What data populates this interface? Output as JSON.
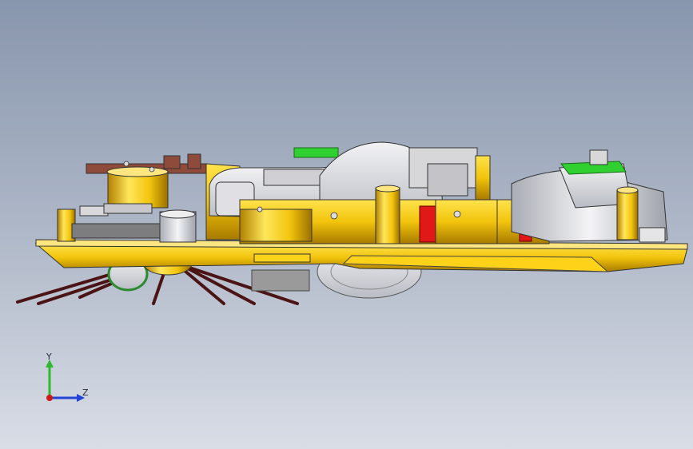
{
  "scene": {
    "background_top": "#8896ad",
    "background_bottom": "#d9dde6",
    "part_colors": {
      "chassis": "#f2c40c",
      "housing": "#e3e3e6",
      "accent_red": "#e01818",
      "accent_green": "#2fd02f",
      "bracket_brown": "#8e4a3a",
      "brush": "#5a1a1a"
    }
  },
  "triad": {
    "y_label": "Y",
    "z_label": "Z",
    "y_color": "#2fb82f",
    "z_color": "#2342d6",
    "origin_color": "#d01818"
  }
}
